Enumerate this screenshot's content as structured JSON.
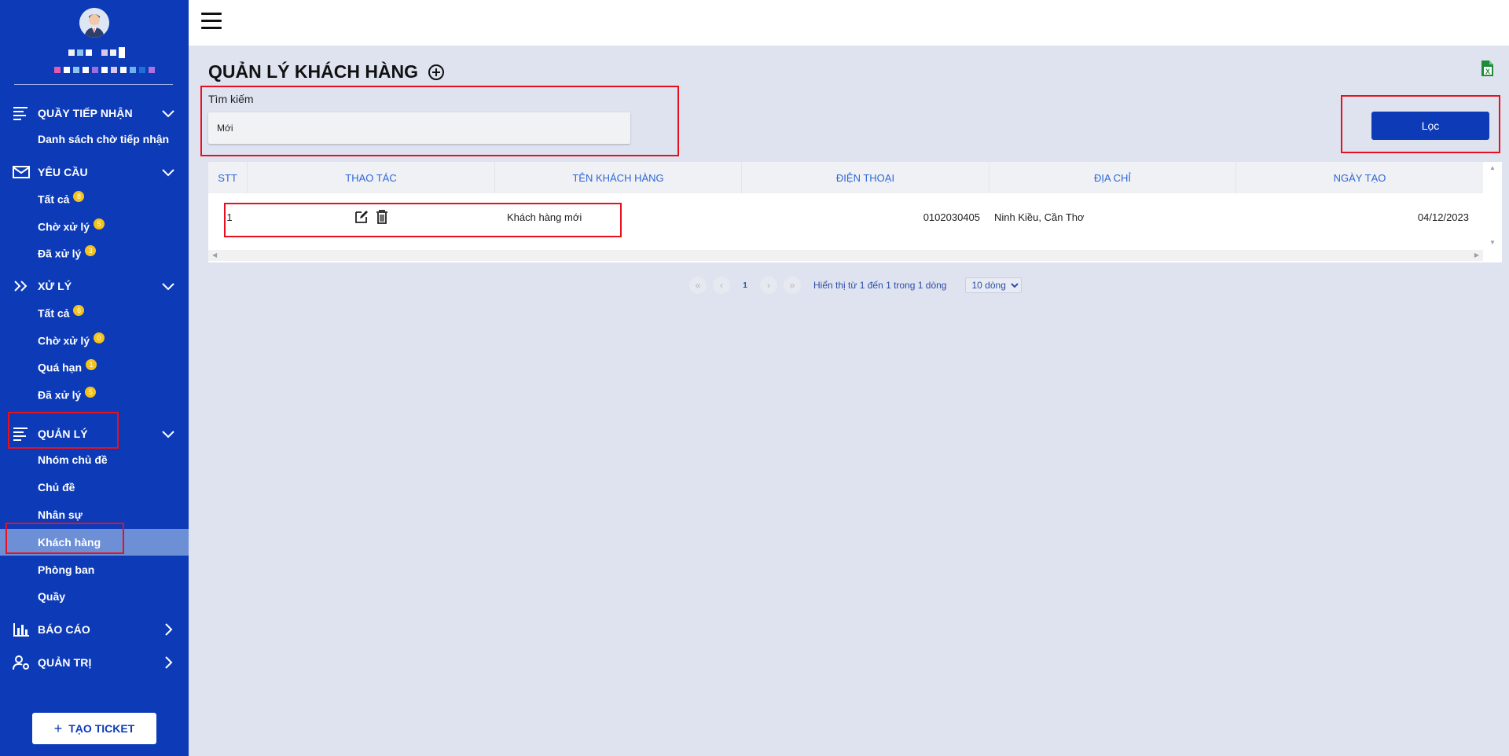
{
  "sidebar": {
    "sections": [
      {
        "label": "QUẦY TIẾP NHẬN",
        "items": [
          {
            "label": "Danh sách chờ tiếp nhận"
          }
        ]
      },
      {
        "label": "YÊU CẦU",
        "items": [
          {
            "label": "Tất cả",
            "badge": "8"
          },
          {
            "label": "Chờ xử lý",
            "badge": "5"
          },
          {
            "label": "Đã xử lý",
            "badge": "3"
          }
        ]
      },
      {
        "label": "XỬ LÝ",
        "items": [
          {
            "label": "Tất cả",
            "badge": "6"
          },
          {
            "label": "Chờ xử lý",
            "badge": "0"
          },
          {
            "label": "Quá hạn",
            "badge": "1"
          },
          {
            "label": "Đã xử lý",
            "badge": "5"
          }
        ]
      },
      {
        "label": "QUẢN LÝ",
        "items": [
          {
            "label": "Nhóm chủ đề"
          },
          {
            "label": "Chủ đề"
          },
          {
            "label": "Nhân sự"
          },
          {
            "label": "Khách hàng"
          },
          {
            "label": "Phòng ban"
          },
          {
            "label": "Quầy"
          }
        ]
      },
      {
        "label": "BÁO CÁO"
      },
      {
        "label": "QUẢN TRỊ"
      }
    ],
    "create_button": "TẠO TICKET"
  },
  "page": {
    "title": "QUẢN LÝ KHÁCH HÀNG"
  },
  "search": {
    "label": "Tìm kiếm",
    "value": "Mới"
  },
  "filter_button": "Lọc",
  "table": {
    "columns": [
      "STT",
      "THAO TÁC",
      "TÊN KHÁCH HÀNG",
      "ĐIỆN THOẠI",
      "ĐỊA CHỈ",
      "NGÀY TẠO"
    ],
    "rows": [
      {
        "stt": "1",
        "name": "Khách hàng mới",
        "phone": "0102030405",
        "address": "Ninh Kiều, Cần Thơ",
        "created": "04/12/2023"
      }
    ]
  },
  "pagination": {
    "first": "«",
    "prev": "‹",
    "current": "1",
    "next": "›",
    "last": "»",
    "info": "Hiển thị từ 1 đến 1 trong 1 dòng",
    "page_size": "10 dòng"
  },
  "colors": {
    "sidebar": "#0d3bb8",
    "active_item": "#6d8fd6",
    "header_text": "#2b66d9",
    "badge": "#f5c21b",
    "highlight": "#e8101c"
  }
}
